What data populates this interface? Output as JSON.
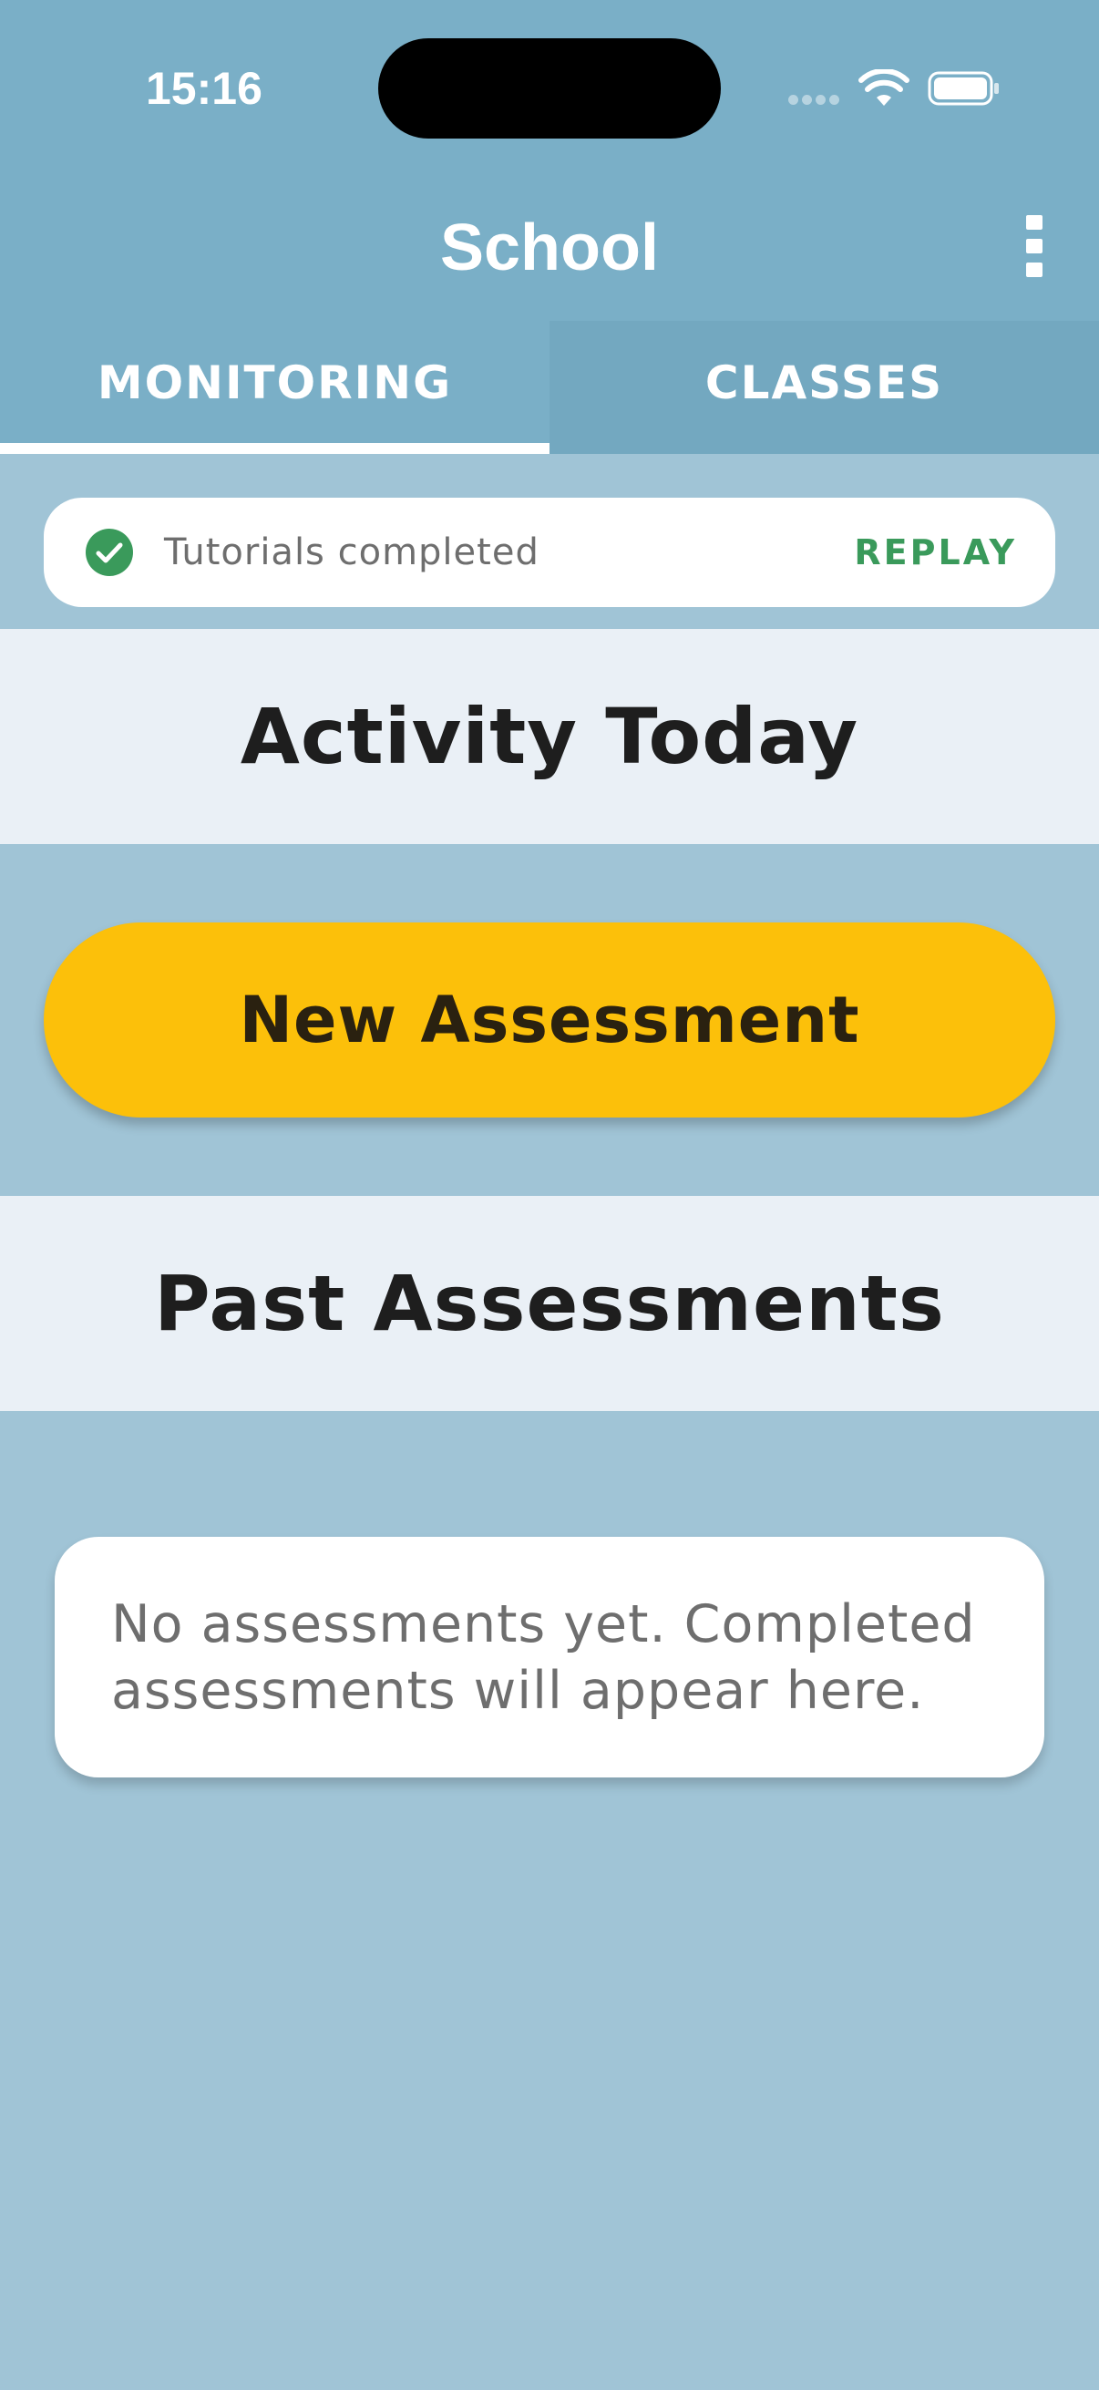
{
  "status_bar": {
    "time": "15:16",
    "icons": [
      "signal-icon",
      "wifi-icon",
      "battery-icon"
    ]
  },
  "app_bar": {
    "title": "School",
    "menu_icon": "more-vertical-icon"
  },
  "tabs": [
    {
      "label": "MONITORING",
      "selected": true
    },
    {
      "label": "CLASSES",
      "selected": false
    }
  ],
  "tutorial_banner": {
    "icon": "check-circle-icon",
    "text": "Tutorials completed",
    "action_label": "REPLAY"
  },
  "sections": {
    "activity_title": "Activity Today",
    "past_title": "Past Assessments"
  },
  "primary_action": {
    "label": "New Assessment"
  },
  "empty_state": {
    "message": "No assessments yet. Completed assessments will appear here."
  },
  "colors": {
    "app_bar": "#7aafc7",
    "background": "#a0c4d6",
    "section_band": "#eaf0f6",
    "primary_button": "#fcc00a",
    "success": "#3a9a5b"
  }
}
